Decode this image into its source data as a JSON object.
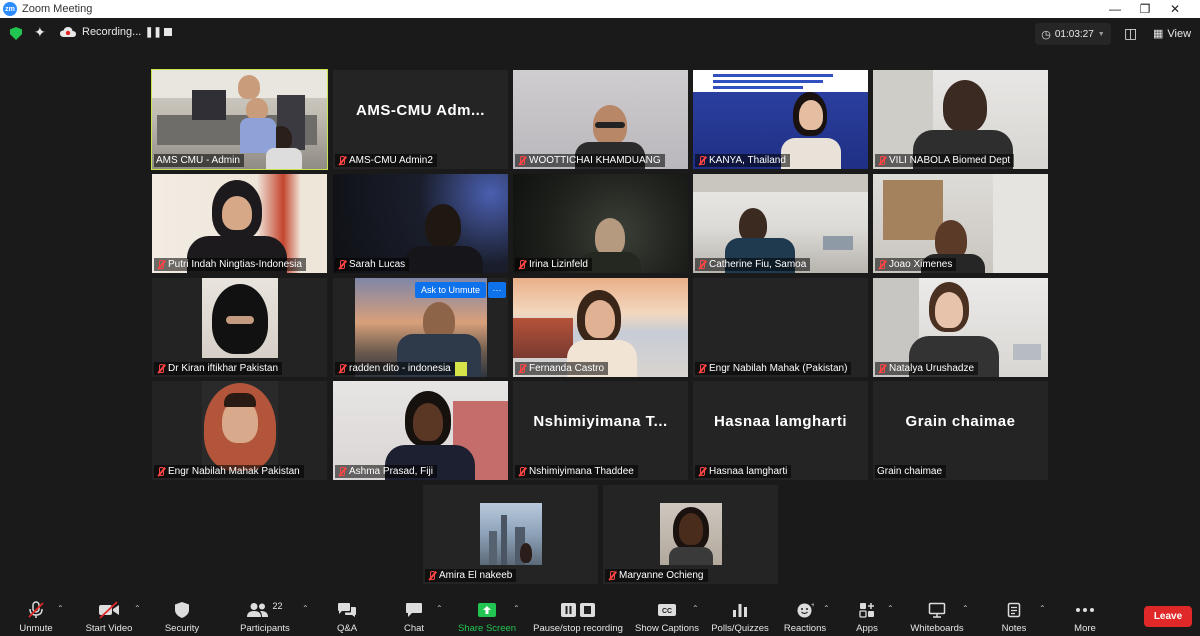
{
  "window": {
    "title": "Zoom Meeting",
    "logo": "zm"
  },
  "topbar": {
    "recording_label": "Recording...",
    "timer": "01:03:27",
    "view_label": "View"
  },
  "ask_to_unmute": "Ask to Unmute",
  "more_dots": "···",
  "participants": [
    {
      "name": "AMS CMU - Admin",
      "muted": false,
      "active": true,
      "bigname": ""
    },
    {
      "name": "AMS-CMU Admin2",
      "muted": true,
      "active": false,
      "bigname": "AMS-CMU  Adm..."
    },
    {
      "name": "WOOTTICHAI KHAMDUANG",
      "muted": true,
      "active": false,
      "bigname": ""
    },
    {
      "name": "KANYA, Thailand",
      "muted": true,
      "active": false,
      "bigname": ""
    },
    {
      "name": "VILI NABOLA Biomed Dept",
      "muted": true,
      "active": false,
      "bigname": ""
    },
    {
      "name": "Putri Indah Ningtias-Indonesia",
      "muted": true,
      "active": false,
      "bigname": ""
    },
    {
      "name": "Sarah Lucas",
      "muted": true,
      "active": false,
      "bigname": ""
    },
    {
      "name": "Irina Lizinfeld",
      "muted": true,
      "active": false,
      "bigname": ""
    },
    {
      "name": "Catherine Fiu, Samoa",
      "muted": true,
      "active": false,
      "bigname": ""
    },
    {
      "name": "Joao Ximenes",
      "muted": true,
      "active": false,
      "bigname": ""
    },
    {
      "name": "Dr Kiran iftikhar Pakistan",
      "muted": true,
      "active": false,
      "bigname": ""
    },
    {
      "name": "radden dito - indonesia",
      "muted": true,
      "active": false,
      "bigname": ""
    },
    {
      "name": "Fernanda Castro",
      "muted": true,
      "active": false,
      "bigname": ""
    },
    {
      "name": "Engr Nabilah Mahak (Pakistan)",
      "muted": true,
      "active": false,
      "bigname": ""
    },
    {
      "name": "Natalya Urushadze",
      "muted": true,
      "active": false,
      "bigname": ""
    },
    {
      "name": "Engr Nabilah Mahak Pakistan",
      "muted": true,
      "active": false,
      "bigname": ""
    },
    {
      "name": "Ashma Prasad, Fiji",
      "muted": true,
      "active": false,
      "bigname": ""
    },
    {
      "name": "Nshimiyimana Thaddee",
      "muted": true,
      "active": false,
      "bigname": "Nshimiyimana  T..."
    },
    {
      "name": "Hasnaa lamgharti",
      "muted": true,
      "active": false,
      "bigname": "Hasnaa lamgharti"
    },
    {
      "name": "Grain chaimae",
      "muted": false,
      "active": false,
      "bigname": "Grain chaimae"
    },
    {
      "name": "Amira El nakeeb",
      "muted": true,
      "active": false,
      "bigname": ""
    },
    {
      "name": "Maryanne Ochieng",
      "muted": true,
      "active": false,
      "bigname": ""
    }
  ],
  "toolbar": {
    "unmute": "Unmute",
    "start_video": "Start Video",
    "security": "Security",
    "participants": "Participants",
    "participants_count": "22",
    "qa": "Q&A",
    "chat": "Chat",
    "share_screen": "Share Screen",
    "pause_recording": "Pause/stop recording",
    "show_captions": "Show Captions",
    "polls": "Polls/Quizzes",
    "reactions": "Reactions",
    "apps": "Apps",
    "whiteboards": "Whiteboards",
    "notes": "Notes",
    "more": "More",
    "leave": "Leave"
  },
  "colors": {
    "background": "#1a1a1a",
    "tile": "#242424",
    "active_border": "#c9e34b",
    "leave": "#e02828",
    "share": "#23c552",
    "accent": "#0e72ed"
  }
}
